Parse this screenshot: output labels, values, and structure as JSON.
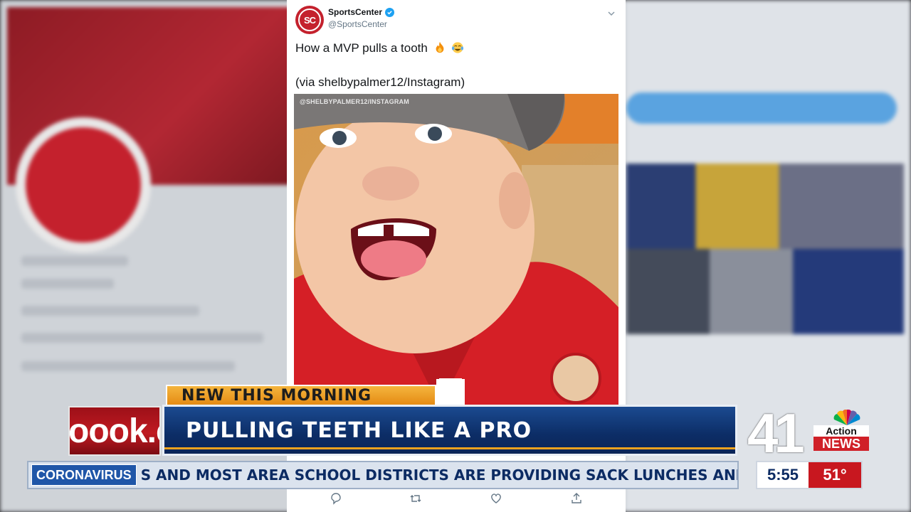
{
  "tweet": {
    "avatar_text": "SC",
    "display_name": "SportsCenter",
    "handle": "@SportsCenter",
    "text": "How a MVP pulls a tooth",
    "emojis": [
      "fire-emoji",
      "tears-of-joy-emoji"
    ],
    "credit": "(via shelbypalmer12/Instagram)",
    "media_watermark": "@SHELBYPALMER12/INSTAGRAM",
    "actions": [
      "reply-icon",
      "retweet-icon",
      "like-icon",
      "share-icon"
    ]
  },
  "lower_third": {
    "kicker": "NEW THIS MORNING",
    "headline": "PULLING TEETH LIKE A PRO",
    "side_logo_text": "oook.c"
  },
  "ticker": {
    "label": "CORONAVIRUS",
    "text": "S AND MOST AREA SCHOOL DISTRICTS ARE PROVIDING SACK LUNCHES AND MEALS TO S"
  },
  "station": {
    "number": "41",
    "line1": "Action",
    "line2": "NEWS"
  },
  "clock": {
    "time": "5:55",
    "temperature": "51°"
  },
  "colors": {
    "headline_blue": "#0c2d66",
    "kicker_orange": "#f0a21e",
    "station_red": "#d02028",
    "twitter_blue": "#1da1f2"
  }
}
